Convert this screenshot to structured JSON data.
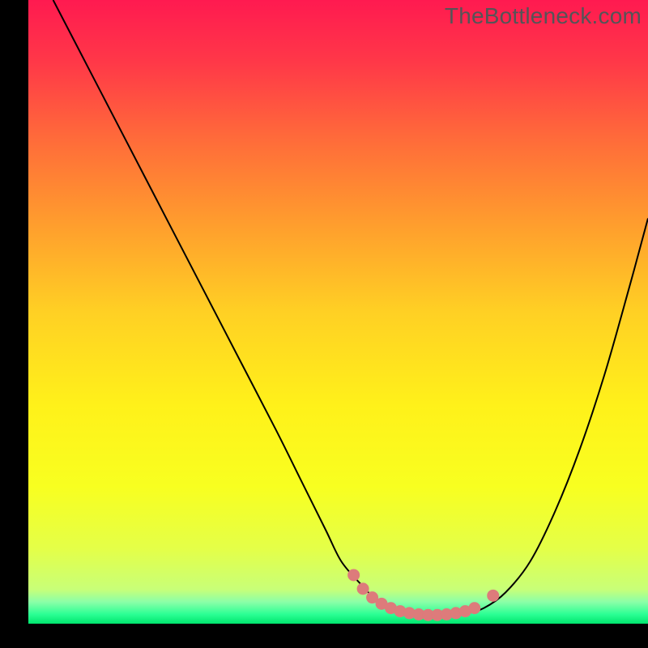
{
  "watermark": "TheBottleneck.com",
  "colors": {
    "gradient_stops": [
      {
        "offset": 0.0,
        "color": "#ff1a50"
      },
      {
        "offset": 0.1,
        "color": "#ff3848"
      },
      {
        "offset": 0.22,
        "color": "#ff6a3a"
      },
      {
        "offset": 0.35,
        "color": "#ff9a2e"
      },
      {
        "offset": 0.5,
        "color": "#ffd024"
      },
      {
        "offset": 0.65,
        "color": "#fff11a"
      },
      {
        "offset": 0.78,
        "color": "#f8ff20"
      },
      {
        "offset": 0.88,
        "color": "#e4ff48"
      },
      {
        "offset": 0.945,
        "color": "#c8ff78"
      },
      {
        "offset": 0.965,
        "color": "#8bffa8"
      },
      {
        "offset": 0.985,
        "color": "#2bff94"
      },
      {
        "offset": 1.0,
        "color": "#00e56d"
      }
    ],
    "curve_stroke": "#000000",
    "marker_fill": "#dd7b7b",
    "marker_stroke": "#dd7b7b",
    "black": "#000000"
  },
  "chart_data": {
    "type": "line",
    "title": "",
    "xlabel": "",
    "ylabel": "",
    "xlim": [
      0,
      100
    ],
    "ylim": [
      0,
      100
    ],
    "series": [
      {
        "name": "bottleneck-curve",
        "x": [
          4,
          10,
          16,
          22,
          28,
          34,
          40,
          44,
          48,
          50.5,
          53.5,
          56,
          59,
          62,
          65,
          68,
          70.5,
          73.5,
          77,
          81,
          85,
          89,
          93,
          97,
          100
        ],
        "y": [
          100,
          88.5,
          77,
          65.5,
          54,
          42.5,
          31,
          23,
          15,
          10,
          6.5,
          4,
          2.4,
          1.6,
          1.3,
          1.3,
          1.6,
          2.5,
          5,
          10,
          18,
          28,
          40,
          54,
          65
        ],
        "style": "smooth"
      }
    ],
    "markers": {
      "name": "highlight-band",
      "points": [
        {
          "x": 52.5,
          "y": 7.8
        },
        {
          "x": 54.0,
          "y": 5.6
        },
        {
          "x": 55.5,
          "y": 4.2
        },
        {
          "x": 57.0,
          "y": 3.2
        },
        {
          "x": 58.5,
          "y": 2.5
        },
        {
          "x": 60.0,
          "y": 2.0
        },
        {
          "x": 61.5,
          "y": 1.7
        },
        {
          "x": 63.0,
          "y": 1.5
        },
        {
          "x": 64.5,
          "y": 1.4
        },
        {
          "x": 66.0,
          "y": 1.4
        },
        {
          "x": 67.5,
          "y": 1.5
        },
        {
          "x": 69.0,
          "y": 1.7
        },
        {
          "x": 70.5,
          "y": 2.0
        },
        {
          "x": 72.0,
          "y": 2.5
        },
        {
          "x": 75.0,
          "y": 4.5
        }
      ],
      "radius_px": 7
    }
  }
}
